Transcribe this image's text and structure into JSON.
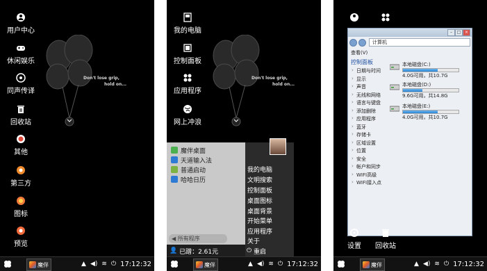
{
  "screen1": {
    "desktop_icons": [
      {
        "label": "用户中心",
        "icon": "user-icon",
        "color": "#ffffff"
      },
      {
        "label": "休闲娱乐",
        "icon": "gamepad-icon",
        "color": "#ffffff"
      },
      {
        "label": "同声传译",
        "icon": "translate-icon",
        "color": "#ffffff"
      },
      {
        "label": "回收站",
        "icon": "trash-icon",
        "color": "#ffffff"
      },
      {
        "label": "其他",
        "icon": "other-icon",
        "color": "#e04a3a"
      },
      {
        "label": "第三方",
        "icon": "third-party-icon",
        "color": "#f08a2a"
      },
      {
        "label": "图标",
        "icon": "icon-theme-icon",
        "color": "#f07a3a"
      },
      {
        "label": "预览",
        "icon": "preview-icon",
        "color": "#f06a3a"
      }
    ]
  },
  "wallpaper": {
    "quote_line1": "Don't lose grip,",
    "quote_line2": "hold on..."
  },
  "taskbar": {
    "app_label": "魔伴",
    "clock": "17:12:32"
  },
  "screen2": {
    "desktop_icons": [
      {
        "label": "我的电脑",
        "icon": "computer-icon"
      },
      {
        "label": "控制面板",
        "icon": "control-panel-icon"
      },
      {
        "label": "应用程序",
        "icon": "apps-icon"
      },
      {
        "label": "网上冲浪",
        "icon": "globe-icon"
      }
    ],
    "start_menu": {
      "pinned": [
        {
          "label": "魔伴桌面",
          "color": "#4caf50"
        },
        {
          "label": "天道输入法",
          "color": "#2e7bd6"
        },
        {
          "label": "普通启动",
          "color": "#7cb342"
        },
        {
          "label": "哈哈日历",
          "color": "#2e7bd6"
        }
      ],
      "all_programs": "所有程序",
      "usage": "已蹭：2.61元",
      "right_items": [
        "我的电脑",
        "文明搜索",
        "控制面板",
        "桌面图标",
        "桌面背景",
        "开始菜单",
        "应用程序",
        "关于"
      ],
      "restart": "重启"
    }
  },
  "screen3": {
    "window": {
      "address": "计算机",
      "view_menu": "查看(V)",
      "panel_title": "控制面板",
      "nav_items": [
        "日期与时间",
        "显示",
        "声音",
        "无线和网络",
        "语言与键盘",
        "添加删除",
        "应用程序",
        "蓝牙",
        "存储卡",
        "区域设置",
        "位置",
        "安全",
        "帐户和同步",
        "WIFI高级",
        "WIFI接入点"
      ],
      "drives": [
        {
          "name": "本地磁盘(C:)",
          "free": "4.0G可用，共10.7G",
          "used_fraction": 0.63
        },
        {
          "name": "本地磁盘(D:)",
          "free": "9.6G可用，共14.8G",
          "used_fraction": 0.35
        },
        {
          "name": "本地磁盘(E:)",
          "free": "4.0G可用，共10.7G",
          "used_fraction": 0.63
        }
      ]
    },
    "bottom_icons": [
      {
        "label": "设置",
        "icon": "settings-icon"
      },
      {
        "label": "回收站",
        "icon": "recycle-bin-icon"
      }
    ]
  }
}
